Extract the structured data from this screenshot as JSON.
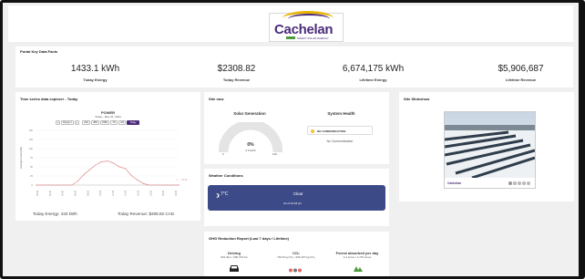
{
  "header": {
    "logo_text": "Cachelan",
    "logo_tagline": "SMART SOLAR ENERGY"
  },
  "kpi": {
    "title": "Portal Key Data Facts",
    "items": [
      {
        "value": "1433.1 kWh",
        "label": "Today Energy"
      },
      {
        "value": "$2308.82",
        "label": "Today Revenue"
      },
      {
        "value": "6,674,175 kWh",
        "label": "Lifetime Energy"
      },
      {
        "value": "$5,906,687",
        "label": "Lifetime Revenue"
      }
    ]
  },
  "timeseries": {
    "title": "Time series data explorer - Today",
    "chart_title": "POWER",
    "chart_subtitle": "Today - May 01, 2021",
    "range_buttons": [
      "◂",
      "Range ▾",
      "▸",
      "24H",
      "48H",
      "168H",
      "7D",
      "1M",
      "Today"
    ],
    "active_button": "Today",
    "footer_energy": "Today Energy: 433 kWh",
    "footer_revenue": "Today Revenue: $308.82 CAD"
  },
  "chart_data": {
    "type": "line",
    "title": "POWER",
    "subtitle": "Today - May 01, 2021",
    "ylabel": "Average Power (kW)",
    "ylim": [
      0,
      150
    ],
    "y_ticks": [
      "150",
      "125",
      "100",
      "75",
      "50",
      "25",
      "0"
    ],
    "x_tick_labels": [
      "00:00",
      "02:00",
      "04:00",
      "06:00",
      "08:00",
      "10:00",
      "12:00",
      "14:00",
      "16:00",
      "18:00",
      "20:00",
      "22:00"
    ],
    "x": [
      0,
      6,
      7,
      8,
      9,
      10,
      11,
      12,
      13,
      14,
      15,
      16,
      17,
      18,
      19,
      24
    ],
    "values": [
      0,
      0,
      10,
      28,
      42,
      55,
      64,
      66,
      60,
      50,
      45,
      26,
      14,
      4,
      0,
      0
    ],
    "annotation": "13:20",
    "line_color": "#e08a8a"
  },
  "site_now": {
    "title": "Site now",
    "solar_generation": "Solar Generation",
    "system_health": "System Health",
    "gauge_value": "0%",
    "gauge_sub": "0.0 kWh",
    "gauge_min": "0",
    "gauge_max": "100",
    "health_badge": "NO COMMUNICATION",
    "health_text": "No Communication"
  },
  "weather": {
    "title": "Weather Conditions",
    "temp": "7°C",
    "condition": "Clear",
    "as_of": "As of 10:18 pm"
  },
  "slideshow": {
    "title": "Site Slideshow",
    "caption": "Cachelan"
  },
  "ghg": {
    "title": "GHG Reduction Report (Last 7 days / Lifetime)",
    "items": [
      {
        "label": "Driving",
        "value": "901.4km / 390,703 km"
      },
      {
        "label": "CO₂",
        "value": "732.8 kg CO₂ / 290,157 kg CO₂"
      },
      {
        "label": "Forest absorbed per day",
        "value": "4.4 acres / 1,715 acres"
      }
    ]
  },
  "colors": {
    "accent": "#4b2c7a",
    "logo_gold": "#e8b400",
    "weather_bg": "#3d4a88",
    "status_yellow": "#f3c13a"
  }
}
